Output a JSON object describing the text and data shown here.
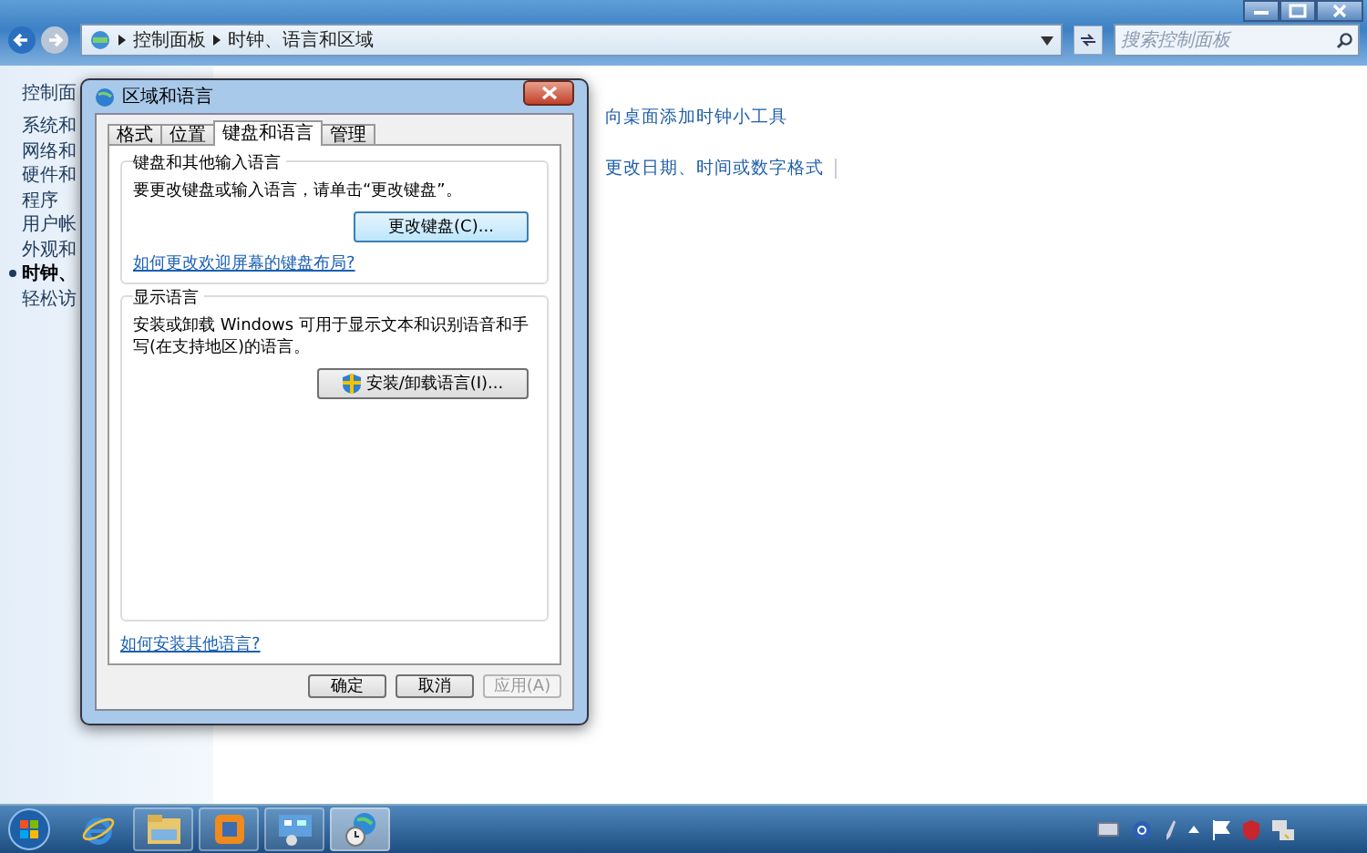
{
  "window": {
    "breadcrumb": [
      "控制面板",
      "时钟、语言和区域"
    ],
    "search": {
      "placeholder": "搜索控制面板"
    }
  },
  "sidebar": {
    "items": [
      {
        "label": "控制面",
        "selected": false
      },
      {
        "label": "系统和",
        "selected": false
      },
      {
        "label": "网络和",
        "selected": false
      },
      {
        "label": "硬件和",
        "selected": false
      },
      {
        "label": "程序",
        "selected": false
      },
      {
        "label": "用户帐",
        "selected": false
      },
      {
        "label": "外观和",
        "selected": false
      },
      {
        "label": "时钟、",
        "selected": true
      },
      {
        "label": "轻松访",
        "selected": false
      }
    ]
  },
  "main": {
    "links": [
      "向桌面添加时钟小工具",
      "更改日期、时间或数字格式"
    ]
  },
  "dialog": {
    "title": "区域和语言",
    "tabs": [
      {
        "label": "格式",
        "selected": false
      },
      {
        "label": "位置",
        "selected": false
      },
      {
        "label": "键盘和语言",
        "selected": true
      },
      {
        "label": "管理",
        "selected": false
      }
    ],
    "keyboard_group": {
      "title": "键盘和其他输入语言",
      "text": "要更改键盘或输入语言，请单击“更改键盘”。",
      "button": "更改键盘(C)...",
      "link": "如何更改欢迎屏幕的键盘布局?"
    },
    "display_group": {
      "title": "显示语言",
      "text": "安装或卸载 Windows 可用于显示文本和识别语音和手写(在支持地区)的语言。",
      "button": "安装/卸载语言(I)..."
    },
    "link": "如何安装其他语言?",
    "buttons": [
      {
        "label": "确定",
        "disabled": false
      },
      {
        "label": "取消",
        "disabled": false
      },
      {
        "label": "应用(A)",
        "disabled": true
      }
    ]
  },
  "taskbar": {
    "items": [
      {
        "kind": "ie",
        "selected": false
      },
      {
        "kind": "folder",
        "selected": false
      },
      {
        "kind": "app",
        "selected": false
      },
      {
        "kind": "control-panel",
        "selected": false
      },
      {
        "kind": "globe-clock",
        "selected": true
      }
    ],
    "tray": [
      {
        "kind": "keyboard"
      },
      {
        "kind": "help"
      },
      {
        "kind": "pen"
      },
      {
        "kind": "arrow"
      },
      {
        "kind": "flag"
      },
      {
        "kind": "shield"
      },
      {
        "kind": "network"
      }
    ]
  }
}
